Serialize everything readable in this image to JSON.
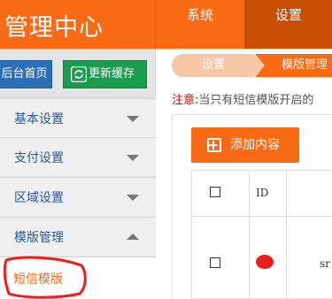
{
  "header": {
    "brand": "管理中心",
    "nav": [
      {
        "label": "系统",
        "active": false
      },
      {
        "label": "设置",
        "active": true
      }
    ]
  },
  "sidebar": {
    "home_button": "后台首页",
    "refresh_button": "更新缓存",
    "items": [
      {
        "label": "基本设置",
        "expanded": false
      },
      {
        "label": "支付设置",
        "expanded": false
      },
      {
        "label": "区域设置",
        "expanded": false
      },
      {
        "label": "模版管理",
        "expanded": true
      }
    ],
    "subitems": [
      {
        "label": "短信模版",
        "active": true
      }
    ]
  },
  "breadcrumb": {
    "items": [
      "设置",
      "模版管理"
    ]
  },
  "notice": {
    "tag": "注意:",
    "text": "当只有短信模版开启的"
  },
  "toolbar": {
    "add_label": "添加内容"
  },
  "table": {
    "columns": [
      "",
      "ID"
    ],
    "rows": [
      {
        "id": "",
        "name": "sr"
      }
    ]
  },
  "colors": {
    "brand": "#f96a15",
    "active_nav": "#c94f04",
    "home_button": "#2b6fb5",
    "refresh_button": "#1b9b4d",
    "notice": "#d20000",
    "annotation": "#ee1c1c"
  }
}
